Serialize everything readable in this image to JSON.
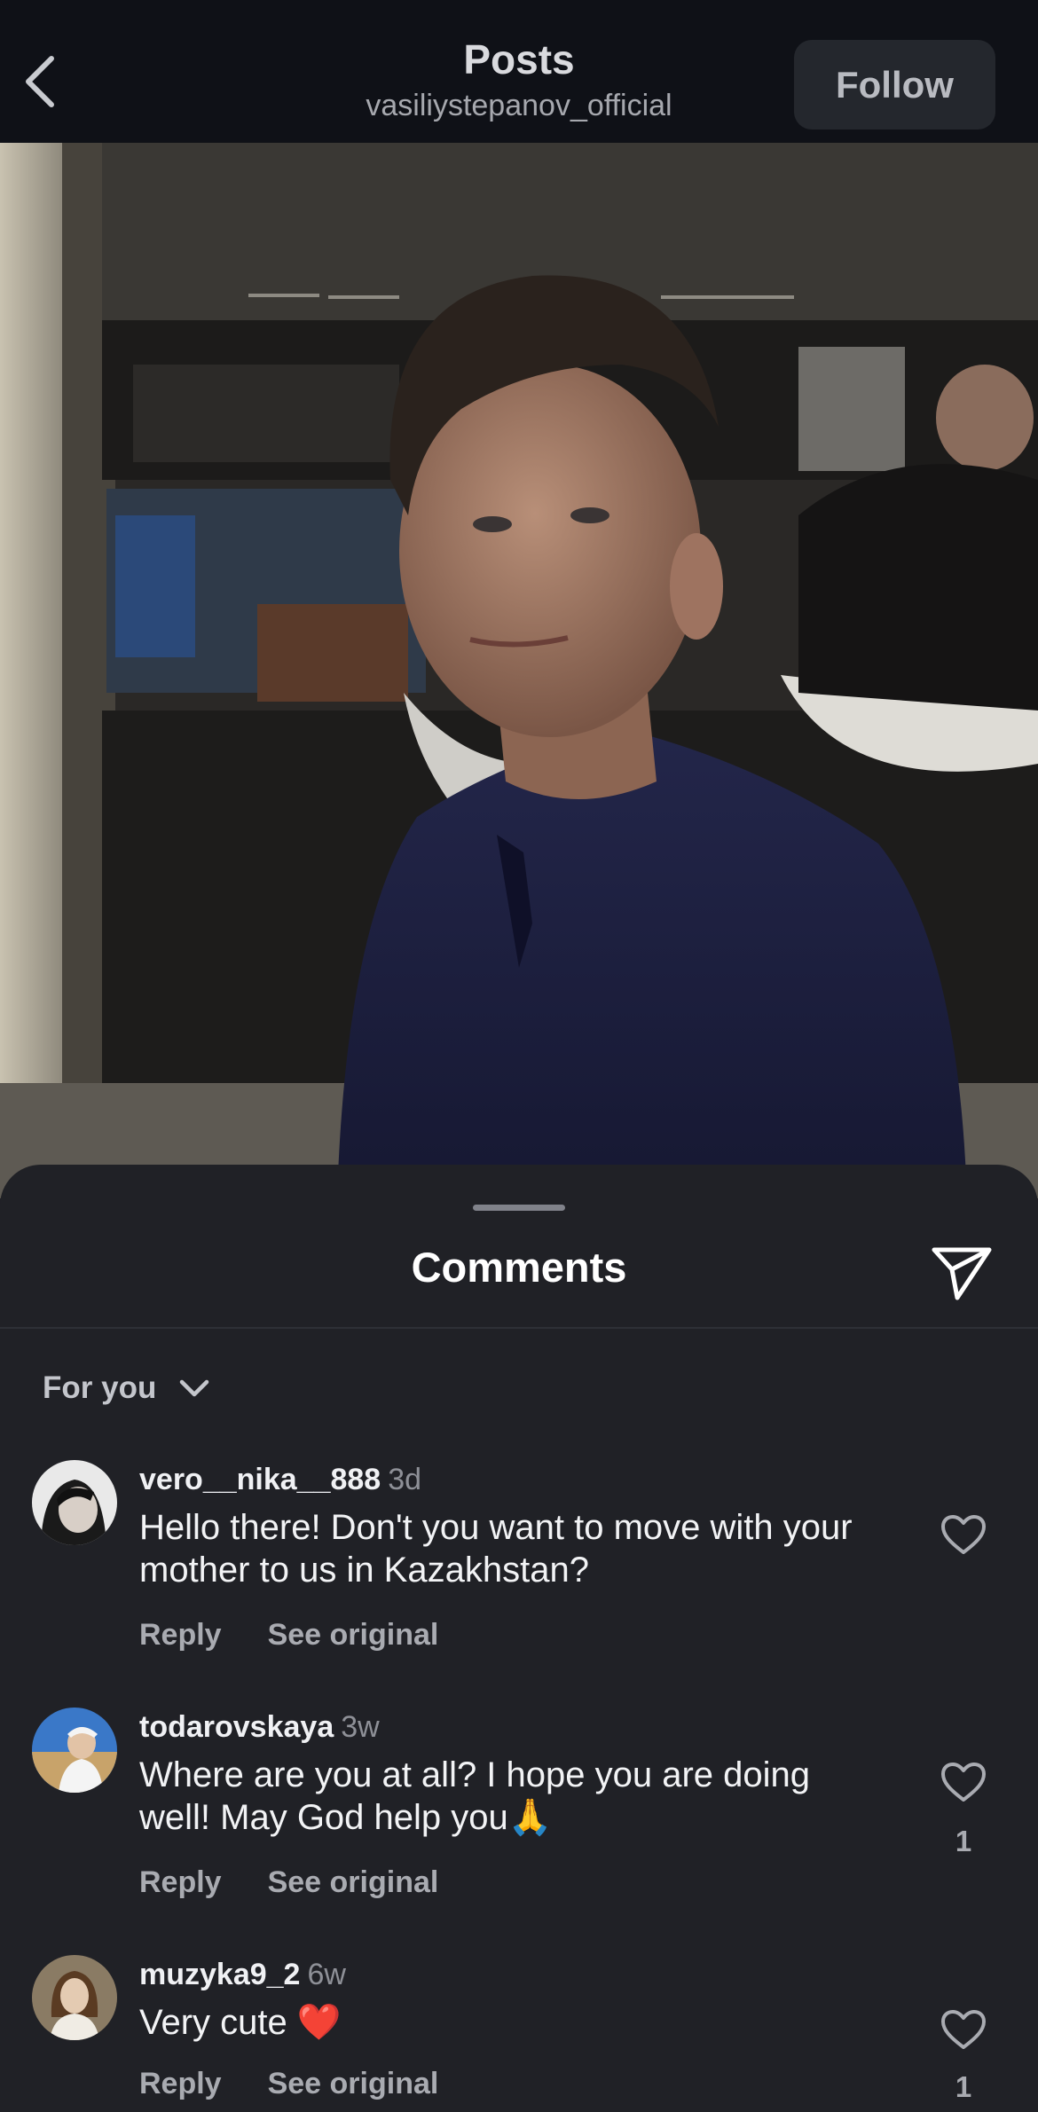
{
  "header": {
    "back_icon": "chevron-left-icon",
    "title": "Posts",
    "subtitle": "vasiliystepanov_official",
    "follow_label": "Follow"
  },
  "photo": {
    "description_icon": "post-photo"
  },
  "comments_sheet": {
    "title": "Comments",
    "share_icon": "paper-plane-icon",
    "sort_label": "For you",
    "sort_icon": "chevron-down-icon",
    "comments": [
      {
        "username": "vero__nika__888",
        "time": "3d",
        "text": "Hello there! Don't you want to move with your mother to us in Kazakhstan?",
        "reply_label": "Reply",
        "see_original_label": "See original",
        "likes": ""
      },
      {
        "username": "todarovskaya",
        "time": "3w",
        "text": "Where are you at all? I hope you are doing well! May God help you🙏",
        "reply_label": "Reply",
        "see_original_label": "See original",
        "likes": "1"
      },
      {
        "username": "muzyka9_2",
        "time": "6w",
        "text": "Very cute ❤️",
        "reply_label": "Reply",
        "see_original_label": "See original",
        "likes": "1"
      }
    ]
  },
  "colors": {
    "header_bg": "#0f1117",
    "sheet_bg": "#202126",
    "follow_bg": "#24272d"
  }
}
